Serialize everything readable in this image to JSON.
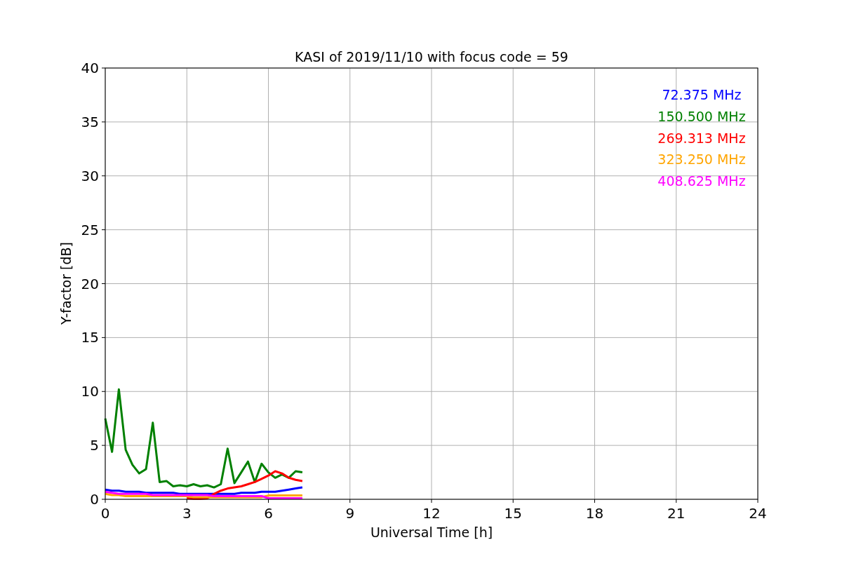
{
  "chart_data": {
    "type": "line",
    "title": "KASI of 2019/11/10 with focus code = 59",
    "xlabel": "Universal Time [h]",
    "ylabel": "Y-factor [dB]",
    "x": [
      0,
      0.25,
      0.5,
      0.75,
      1,
      1.25,
      1.5,
      1.75,
      2,
      2.25,
      2.5,
      2.75,
      3,
      3.25,
      3.5,
      3.75,
      4,
      4.25,
      4.5,
      4.75,
      5,
      5.25,
      5.5,
      5.75,
      6,
      6.25,
      6.5,
      6.75,
      7,
      7.25
    ],
    "series": [
      {
        "name": "72.375 MHz",
        "color": "#0000ff",
        "values": [
          0.9,
          0.8,
          0.8,
          0.7,
          0.7,
          0.7,
          0.6,
          0.6,
          0.6,
          0.6,
          0.6,
          0.5,
          0.5,
          0.5,
          0.5,
          0.5,
          0.5,
          0.5,
          0.5,
          0.5,
          0.6,
          0.6,
          0.6,
          0.7,
          0.7,
          0.7,
          0.8,
          0.9,
          1.0,
          1.1
        ]
      },
      {
        "name": "150.500 MHz",
        "color": "#008000",
        "values": [
          7.5,
          4.4,
          10.2,
          4.6,
          3.2,
          2.4,
          2.8,
          7.1,
          1.6,
          1.7,
          1.2,
          1.3,
          1.2,
          1.4,
          1.2,
          1.3,
          1.1,
          1.4,
          4.7,
          1.5,
          2.5,
          3.5,
          1.6,
          3.3,
          2.5,
          2.0,
          2.3,
          2.0,
          2.6,
          2.5
        ]
      },
      {
        "name": "269.313 MHz",
        "color": "#ff0000",
        "values": [
          null,
          null,
          null,
          null,
          null,
          null,
          null,
          null,
          null,
          null,
          null,
          null,
          0.1,
          0.05,
          0.05,
          0.1,
          0.5,
          0.8,
          1.0,
          1.1,
          1.2,
          1.4,
          1.6,
          1.9,
          2.2,
          2.6,
          2.4,
          2.0,
          1.8,
          1.7
        ]
      },
      {
        "name": "323.250 MHz",
        "color": "#ffa500",
        "values": [
          0.5,
          0.4,
          0.4,
          0.3,
          0.3,
          0.3,
          0.3,
          0.3,
          0.3,
          0.3,
          0.3,
          0.3,
          0.3,
          0.2,
          0.2,
          0.2,
          0.2,
          0.2,
          0.2,
          0.2,
          0.2,
          0.2,
          0.2,
          0.2,
          0.35,
          0.35,
          0.35,
          0.35,
          0.35,
          0.35
        ]
      },
      {
        "name": "408.625 MHz",
        "color": "#ff00ff",
        "values": [
          0.7,
          0.6,
          0.5,
          0.5,
          0.5,
          0.5,
          0.5,
          0.4,
          0.4,
          0.4,
          0.4,
          0.4,
          0.4,
          0.4,
          0.4,
          0.4,
          0.3,
          0.3,
          0.3,
          0.3,
          0.3,
          0.3,
          0.3,
          0.3,
          0.1,
          0.1,
          0.1,
          0.1,
          0.1,
          0.1
        ]
      }
    ],
    "grid": true,
    "xlim": [
      0,
      24
    ],
    "ylim": [
      0,
      40
    ],
    "xticks": [
      0,
      3,
      6,
      9,
      12,
      15,
      18,
      21,
      24
    ],
    "yticks": [
      0,
      5,
      10,
      15,
      20,
      25,
      30,
      35,
      40
    ]
  }
}
